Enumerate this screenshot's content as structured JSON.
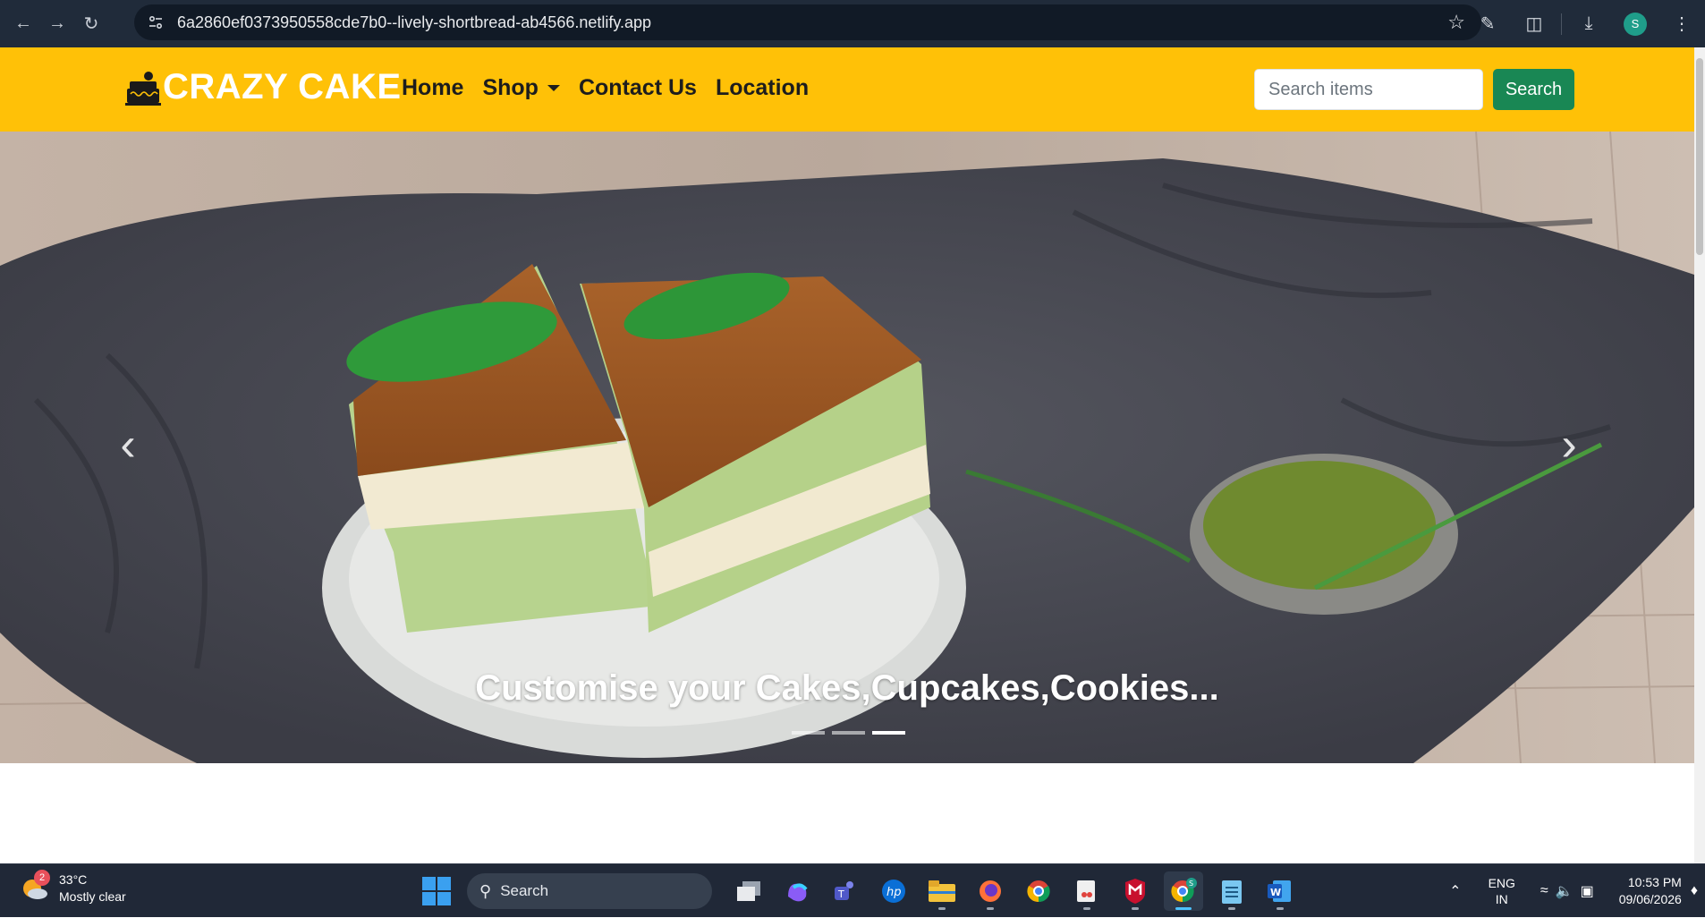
{
  "browser": {
    "url": "6a2860ef0373950558cde7b0--lively-shortbread-ab4566.netlify.app",
    "profile_initial": "S",
    "icons": [
      "back-icon",
      "forward-icon",
      "reload-icon",
      "site-info-icon",
      "bookmark-star-icon",
      "edit-icon",
      "extensions-icon",
      "download-icon",
      "menu-icon"
    ]
  },
  "site": {
    "brand": "CRAZY CAKE",
    "nav": {
      "home": "Home",
      "shop": "Shop",
      "contact": "Contact Us",
      "location": "Location"
    },
    "search": {
      "placeholder": "Search items",
      "button": "Search"
    },
    "colors": {
      "navbar": "#ffc107",
      "search_button": "#198754"
    }
  },
  "carousel": {
    "caption": "Customise your Cakes,Cupcakes,Cookies...",
    "prev_label": "‹",
    "next_label": "›",
    "slide_count": 3,
    "active_index": 2
  },
  "taskbar": {
    "weather": {
      "temp": "33°C",
      "desc": "Mostly clear",
      "badge": "2"
    },
    "search_label": "Search",
    "apps": [
      "task-view",
      "copilot",
      "teams",
      "hp",
      "file-explorer",
      "firefox",
      "chrome",
      "snipping-tool",
      "mcafee",
      "chrome-profile",
      "notepad",
      "word"
    ],
    "active_app": "chrome-profile",
    "lang_line1": "ENG",
    "lang_line2": "IN",
    "time": "10:53 PM",
    "date": "09/06/2026"
  }
}
